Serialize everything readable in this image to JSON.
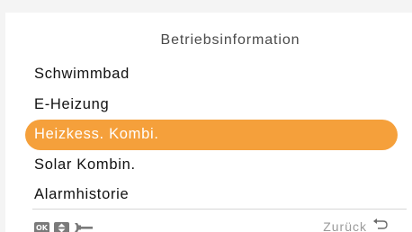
{
  "header": {
    "title": "Betriebsinformation"
  },
  "menu": {
    "items": [
      {
        "label": "Schwimmbad"
      },
      {
        "label": "E-Heizung"
      },
      {
        "label": "Heizkess. Kombi."
      },
      {
        "label": "Solar Kombin."
      },
      {
        "label": "Alarmhistorie"
      }
    ],
    "selected_index": 2
  },
  "footer": {
    "ok_label": "OK",
    "back_label": "Zurück",
    "icons": [
      "ok-icon",
      "up-down-icon",
      "wrench-icon",
      "back-arrow-icon"
    ]
  },
  "colors": {
    "accent": "#f5a03b",
    "background": "#ffffff",
    "text": "#111111",
    "muted": "#9a9a9a"
  }
}
